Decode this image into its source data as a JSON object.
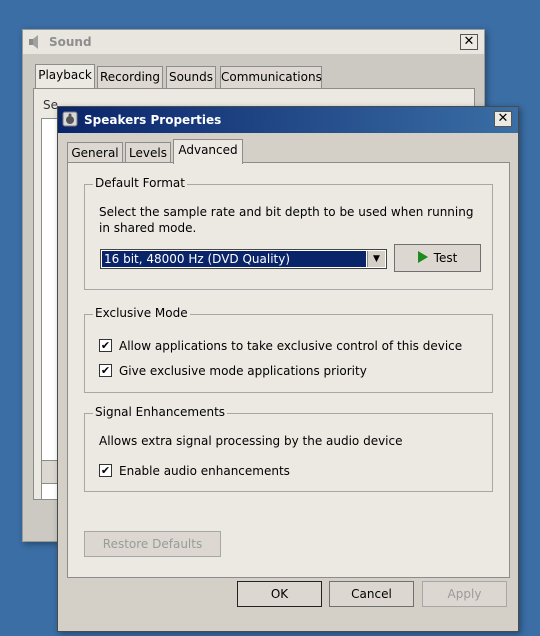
{
  "sound_window": {
    "title": "Sound",
    "tabs": [
      "Playback",
      "Recording",
      "Sounds",
      "Communications"
    ],
    "active_tab": "Playback",
    "peek_text": "Se"
  },
  "speakers_window": {
    "title": "Speakers Properties",
    "tabs": [
      "General",
      "Levels",
      "Advanced"
    ],
    "active_tab": "Advanced",
    "default_format": {
      "title": "Default Format",
      "description_line1": "Select the sample rate and bit depth to be used when running",
      "description_line2": "in shared mode.",
      "selected": "16 bit, 48000 Hz (DVD Quality)",
      "test_label": "Test"
    },
    "exclusive_mode": {
      "title": "Exclusive Mode",
      "allow_label": "Allow applications to take exclusive control of this device",
      "allow_checked": true,
      "priority_label": "Give exclusive mode applications priority",
      "priority_checked": true
    },
    "signal_enhancements": {
      "title": "Signal Enhancements",
      "description": "Allows extra signal processing by the audio device",
      "enable_label": "Enable audio enhancements",
      "enable_checked": true
    },
    "restore_defaults_label": "Restore Defaults",
    "ok_label": "OK",
    "cancel_label": "Cancel",
    "apply_label": "Apply",
    "check_glyph": "✔",
    "close_glyph": "✕"
  },
  "colors": {
    "titlebar_active_start": "#0a246a",
    "titlebar_active_end": "#3a6ea5",
    "desktop": "#3a6ea5",
    "play_icon": "#1f8a1f"
  }
}
